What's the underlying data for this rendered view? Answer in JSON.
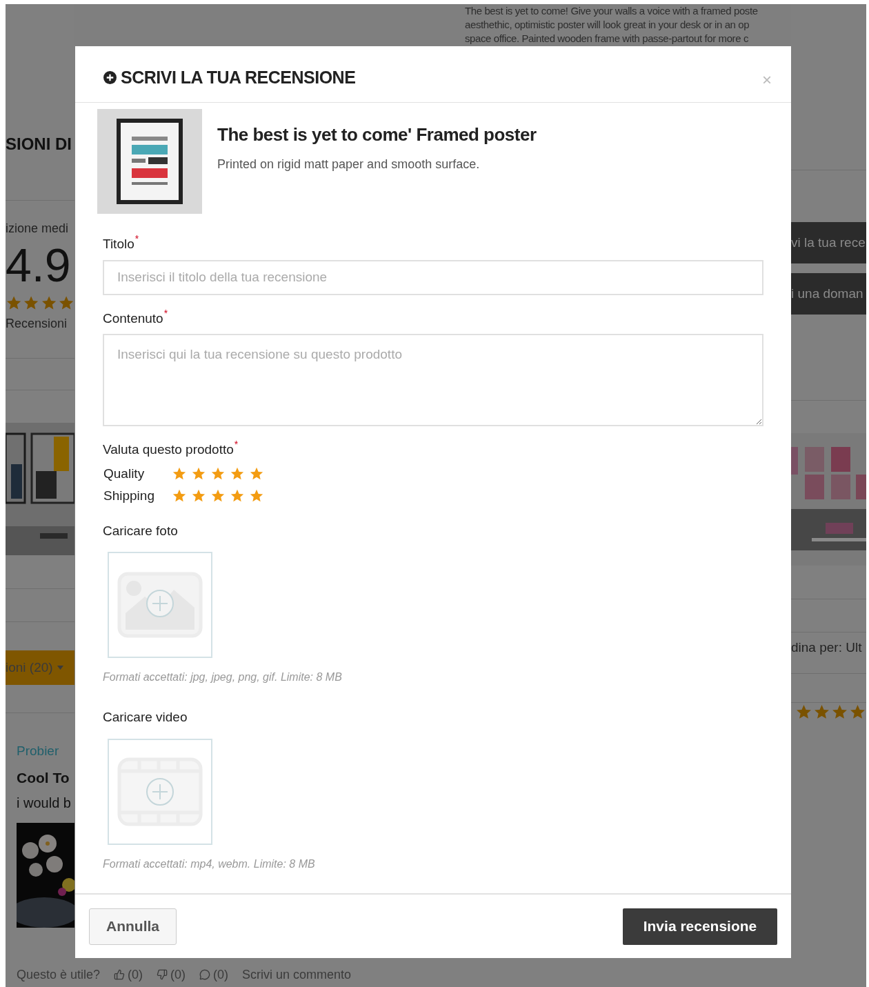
{
  "background": {
    "description_lines": [
      "The best is yet to come! Give your walls a voice with a framed poste",
      "aesthethic, optimistic poster will look great in your desk or in an op",
      "space office. Painted wooden frame with passe-partout for more c"
    ],
    "left": {
      "section_title": "SIONI DI",
      "rating_label": "izione medi",
      "rating_value": "4.9",
      "stars": 4,
      "count_label": "Recensioni",
      "filter_button": "ioni (20)",
      "review_author": "Probier",
      "review_title": "Cool To",
      "review_text": "i would b"
    },
    "right": {
      "buttons": [
        "vi la tua rece",
        "i una doman"
      ],
      "sort_label": "dina per: Ult",
      "stars": 4
    },
    "footer": {
      "helpful_label": "Questo è utile?",
      "likes": "(0)",
      "dislikes": "(0)",
      "comments": "(0)",
      "comment_link": "Scrivi un commento"
    }
  },
  "modal": {
    "title": "SCRIVI LA TUA RECENSIONE",
    "close": "×",
    "product": {
      "name": "The best is yet to come' Framed poster",
      "description": "Printed on rigid matt paper and smooth surface."
    },
    "fields": [
      {
        "kind": "input",
        "label": "Titolo",
        "required_mark": "*",
        "placeholder": "Inserisci il titolo della tua recensione"
      },
      {
        "kind": "textarea",
        "label": "Contenuto",
        "required_mark": "*",
        "placeholder": "Inserisci qui la tua recensione su questo prodotto"
      }
    ],
    "rating": {
      "label": "Valuta questo prodotto",
      "required_mark": "*",
      "criteria": [
        {
          "name": "Quality",
          "stars": 5
        },
        {
          "name": "Shipping",
          "stars": 5
        }
      ]
    },
    "uploads": [
      {
        "label": "Caricare foto",
        "hint": "Formati accettati: jpg, jpeg, png, gif. Limite: 8 MB"
      },
      {
        "kind": "video",
        "label": "Caricare video",
        "hint": "Formati accettati: mp4, webm. Limite: 8 MB"
      }
    ],
    "buttons": {
      "cancel": "Annulla",
      "submit": "Invia recensione"
    }
  }
}
